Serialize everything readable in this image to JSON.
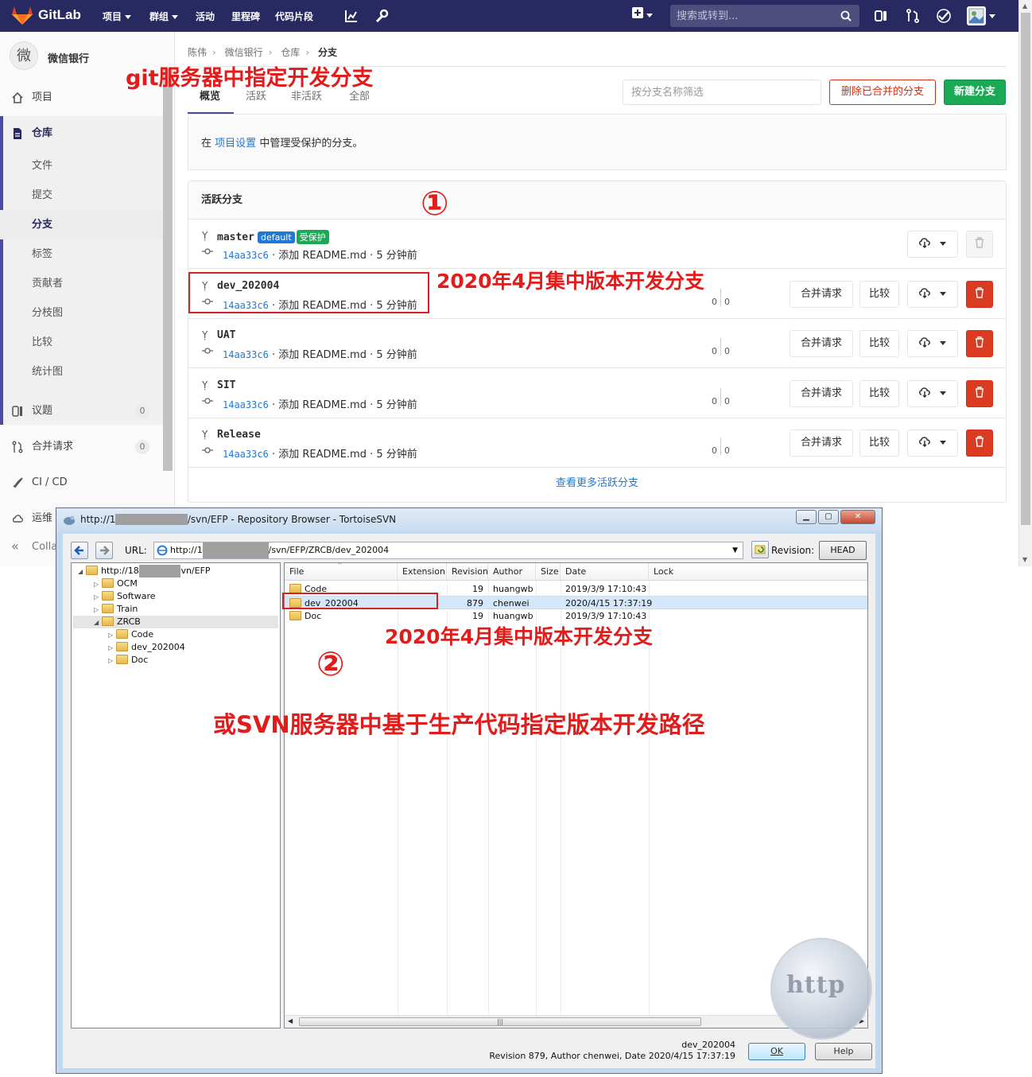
{
  "navbar": {
    "brand": "GitLab",
    "items": [
      {
        "label": "项目",
        "dropdown": true
      },
      {
        "label": "群组",
        "dropdown": true
      },
      {
        "label": "活动",
        "dropdown": false
      },
      {
        "label": "里程碑",
        "dropdown": false
      },
      {
        "label": "代码片段",
        "dropdown": false
      }
    ],
    "search_placeholder": "搜索或转到...",
    "icons": [
      "chart-icon",
      "wrench-icon",
      "plus-square-icon",
      "issues-icon",
      "merge-request-icon",
      "todo-icon",
      "user-avatar-icon"
    ],
    "bg_color": "#292961"
  },
  "sidebar": {
    "avatar_letter": "微",
    "project_name": "微信银行",
    "top_items": [
      {
        "label": "项目",
        "icon": "home-icon"
      },
      {
        "label": "仓库",
        "icon": "doc-icon"
      }
    ],
    "repo_items": [
      "文件",
      "提交",
      "分支",
      "标签",
      "贡献者",
      "分枝图",
      "比较",
      "统计图"
    ],
    "current": "分支",
    "bottom_items": [
      {
        "label": "议题",
        "icon": "issues-icon",
        "count": "0"
      },
      {
        "label": "合并请求",
        "icon": "merge-request-icon",
        "count": "0"
      },
      {
        "label": "CI / CD",
        "icon": "rocket-icon"
      },
      {
        "label": "运维",
        "icon": "cloud-icon"
      }
    ],
    "collapse_label": "Colla"
  },
  "breadcrumb": [
    "陈伟",
    "微信银行",
    "仓库",
    "分支"
  ],
  "tabs": [
    "概览",
    "活跃",
    "非活跃",
    "全部"
  ],
  "active_tab": "概览",
  "filter_placeholder": "按分支名称筛选",
  "buttons": {
    "delete_merged": "删除已合并的分支",
    "new_branch": "新建分支"
  },
  "protected_info": {
    "prefix": "在",
    "link": "项目设置",
    "suffix": "中管理受保护的分支。"
  },
  "active_branches": {
    "title": "活跃分支",
    "rows": [
      {
        "name": "master",
        "badges": [
          "default",
          "受保护"
        ],
        "sha": "14aa33c6",
        "message": "· 添加 README.md · 5 分钟前",
        "behind": "",
        "ahead": "",
        "actions": false
      },
      {
        "name": "dev_202004",
        "badges": [],
        "sha": "14aa33c6",
        "message": "· 添加 README.md · 5 分钟前",
        "behind": "0",
        "ahead": "0",
        "actions": true
      },
      {
        "name": "UAT",
        "badges": [],
        "sha": "14aa33c6",
        "message": "· 添加 README.md · 5 分钟前",
        "behind": "0",
        "ahead": "0",
        "actions": true
      },
      {
        "name": "SIT",
        "badges": [],
        "sha": "14aa33c6",
        "message": "· 添加 README.md · 5 分钟前",
        "behind": "0",
        "ahead": "0",
        "actions": true
      },
      {
        "name": "Release",
        "badges": [],
        "sha": "14aa33c6",
        "message": "· 添加 README.md · 5 分钟前",
        "behind": "0",
        "ahead": "0",
        "actions": true
      }
    ],
    "merge_label": "合并请求",
    "compare_label": "比较",
    "more_link": "查看更多活跃分支"
  },
  "annotations": {
    "git_title": "git服务器中指定开发分支",
    "circle1": "①",
    "dev_branch_note": "2020年4月集中版本开发分支",
    "svn_branch_note": "2020年4月集中版本开发分支",
    "circle2": "②",
    "svn_path_note": "或SVN服务器中基于生产代码指定版本开发路径",
    "color": "#e21b1b"
  },
  "svn": {
    "title_prefix": "http://1",
    "title_suffix": "/svn/EFP - Repository Browser - TortoiseSVN",
    "url_label": "URL:",
    "url_prefix": "http://1",
    "url_suffix": "/svn/EFP/ZRCB/dev_202004",
    "revision_label": "Revision:",
    "revision_button": "HEAD",
    "tree": {
      "root_prefix": "http://18",
      "root_suffix": "vn/EFP",
      "children": [
        "OCM",
        "Software",
        "Train",
        "ZRCB"
      ],
      "zrcb_children": [
        "Code",
        "dev_202004",
        "Doc"
      ]
    },
    "columns": [
      "File",
      "Extension",
      "Revision",
      "Author",
      "Size",
      "Date",
      "Lock"
    ],
    "rows": [
      {
        "file": "Code",
        "revision": "19",
        "author": "huangwb",
        "date": "2019/3/9 17:10:43"
      },
      {
        "file": "dev_202004",
        "revision": "879",
        "author": "chenwei",
        "date": "2020/4/15 17:37:19"
      },
      {
        "file": "Doc",
        "revision": "19",
        "author": "huangwb",
        "date": "2019/3/9 17:10:43"
      }
    ],
    "status_line1": "dev_202004",
    "status_line2": "Revision 879, Author chenwei, Date 2020/4/15 17:37:19",
    "ok_label": "OK",
    "help_label": "Help",
    "watermark": "http"
  }
}
